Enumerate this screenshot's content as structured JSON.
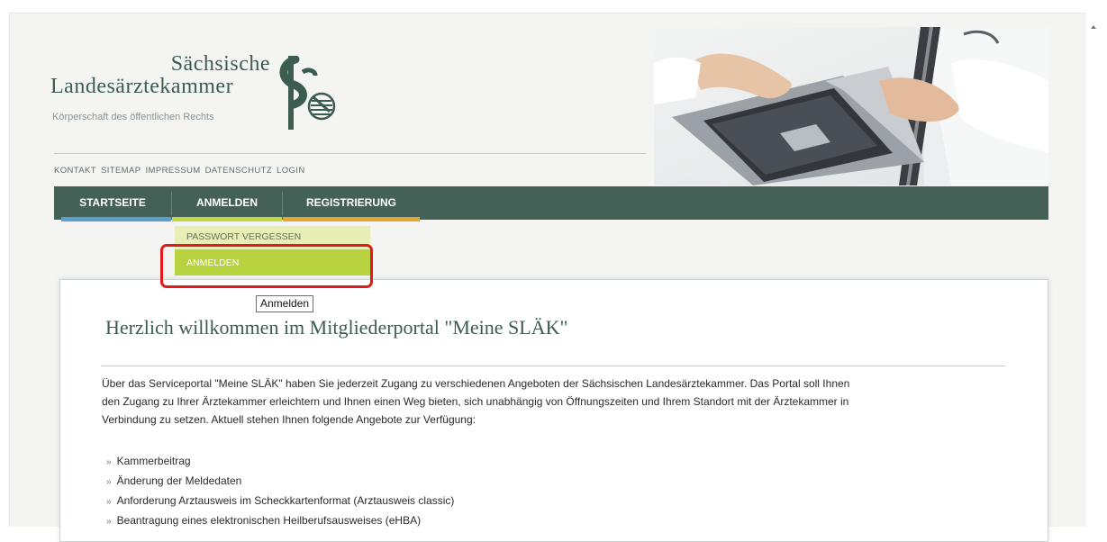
{
  "logo": {
    "line1": "Sächsische",
    "line2": "Landesärztekammer",
    "line3": "Körperschaft des öffentlichen Rechts"
  },
  "util_links": [
    "KONTAKT",
    "SITEMAP",
    "IMPRESSUM",
    "DATENSCHUTZ",
    "LOGIN"
  ],
  "nav": {
    "items": [
      "STARTSEITE",
      "ANMELDEN",
      "REGISTRIERUNG"
    ],
    "underline_colors": [
      "#5aa0cf",
      "#c3d746",
      "#e0a832"
    ]
  },
  "dropdown": {
    "items": [
      "PASSWORT VERGESSEN",
      "ANMELDEN"
    ]
  },
  "tooltip": "Anmelden",
  "content": {
    "heading": "Herzlich willkommen im Mitgliederportal \"Meine SLÄK\"",
    "intro_lines": [
      "Über das Serviceportal \"Meine SLÄK\" haben Sie jederzeit Zugang zu verschiedenen Angeboten der Sächsischen Landesärztekammer. Das Portal soll Ihnen",
      "den Zugang zu Ihrer Ärztekammer erleichtern und Ihnen einen Weg bieten, sich unabhängig von Öffnungszeiten und Ihrem Standort mit der Ärztekammer in",
      "Verbindung zu setzen. Aktuell stehen Ihnen folgende Angebote zur Verfügung:"
    ],
    "bullet_symbol": "»",
    "offers": [
      "Kammerbeitrag",
      "Änderung der Meldedaten",
      "Anforderung Arztausweis im Scheckkartenformat (Arztausweis classic)",
      "Beantragung eines elektronischen Heilberufsausweises (eHBA)"
    ]
  },
  "colors": {
    "nav_bg": "#446157",
    "dropdown_hover": "#b9d340",
    "highlight": "#e11a1a"
  }
}
